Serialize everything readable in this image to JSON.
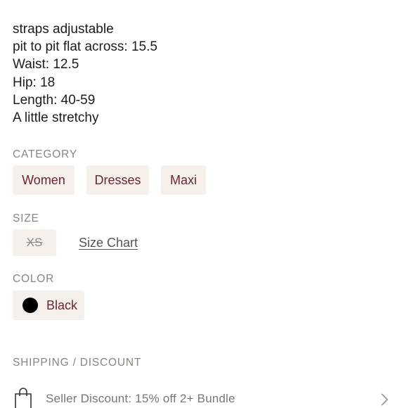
{
  "description": {
    "lines": [
      "straps adjustable",
      "pit to pit flat across: 15.5",
      "Waist: 12.5",
      "Hip: 18",
      "Length: 40-59",
      "A little stretchy"
    ]
  },
  "category": {
    "label": "CATEGORY",
    "chips": [
      "Women",
      "Dresses",
      "Maxi"
    ]
  },
  "size": {
    "label": "SIZE",
    "selected": "XS",
    "size_chart_link": "Size Chart"
  },
  "color": {
    "label": "COLOR",
    "value": "Black",
    "swatch_hex": "#000000"
  },
  "shipping": {
    "label": "SHIPPING / DISCOUNT",
    "seller_discount": "Seller Discount: 15% off 2+ Bundle",
    "icon": "shopping-bag-icon"
  },
  "colors": {
    "chip_bg": "#f5f0ec",
    "chip_text": "#6b2632",
    "label_gray": "#8a857f"
  }
}
